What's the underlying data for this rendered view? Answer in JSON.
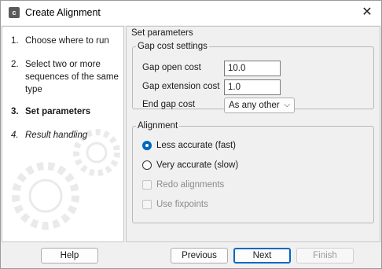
{
  "window": {
    "title": "Create Alignment",
    "app_icon": "clc-app-icon",
    "close_icon": "close-icon"
  },
  "steps": [
    {
      "num": "1.",
      "label": "Choose where to run",
      "state": "done"
    },
    {
      "num": "2.",
      "label": "Select two or more sequences of the same type",
      "state": "done"
    },
    {
      "num": "3.",
      "label": "Set parameters",
      "state": "current"
    },
    {
      "num": "4.",
      "label": "Result handling",
      "state": "pending"
    }
  ],
  "content": {
    "title": "Set parameters",
    "gap": {
      "legend": "Gap cost settings",
      "open_label": "Gap open cost",
      "open_value": "10.0",
      "extension_label": "Gap extension cost",
      "extension_value": "1.0",
      "end_label": "End gap cost",
      "end_value": "As any other"
    },
    "alignment": {
      "legend": "Alignment",
      "less_accurate": "Less accurate (fast)",
      "very_accurate": "Very accurate (slow)",
      "redo": "Redo alignments",
      "fixpoints": "Use fixpoints",
      "selected": "less_accurate"
    }
  },
  "buttons": {
    "help": "Help",
    "previous": "Previous",
    "next": "Next",
    "finish": "Finish"
  },
  "colors": {
    "accent": "#0067c0"
  }
}
